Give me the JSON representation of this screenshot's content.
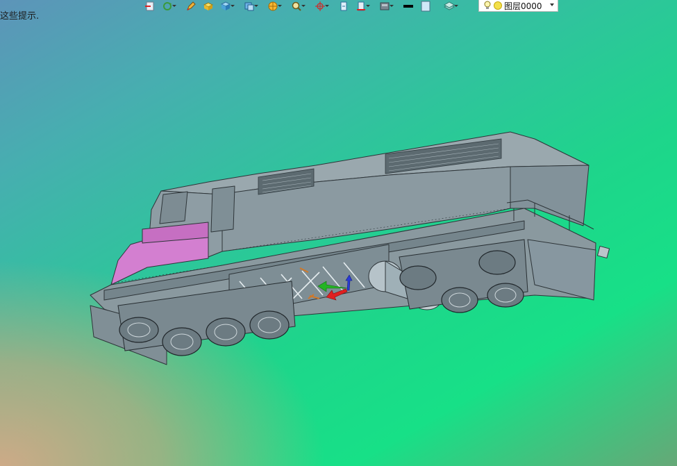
{
  "status": {
    "hint_text": "这些提示."
  },
  "toolbar": {
    "buttons": [
      {
        "icon": "exit-view-icon"
      },
      {
        "icon": "rotate-view-icon"
      },
      {
        "icon": "sketch-pen-icon"
      },
      {
        "icon": "box-select-icon"
      },
      {
        "icon": "cube-icon"
      },
      {
        "icon": "named-views-icon"
      },
      {
        "icon": "render-style-icon"
      },
      {
        "icon": "zoom-icon"
      },
      {
        "icon": "pan-icon"
      },
      {
        "icon": "clip-plane-icon"
      },
      {
        "icon": "section-view-icon"
      },
      {
        "icon": "display-mode-icon"
      },
      {
        "icon": "line-color-icon"
      },
      {
        "icon": "fill-color-icon"
      },
      {
        "icon": "layers-icon"
      }
    ],
    "layer_selector": {
      "value": "图层0000"
    }
  },
  "colors": {
    "body_gray": "#8d9ca3",
    "cab_pink": "#d37fd0",
    "grill_dark": "#5c6a70",
    "axis_x": "#e02020",
    "axis_y": "#24b424",
    "axis_z": "#2a3bd6"
  }
}
